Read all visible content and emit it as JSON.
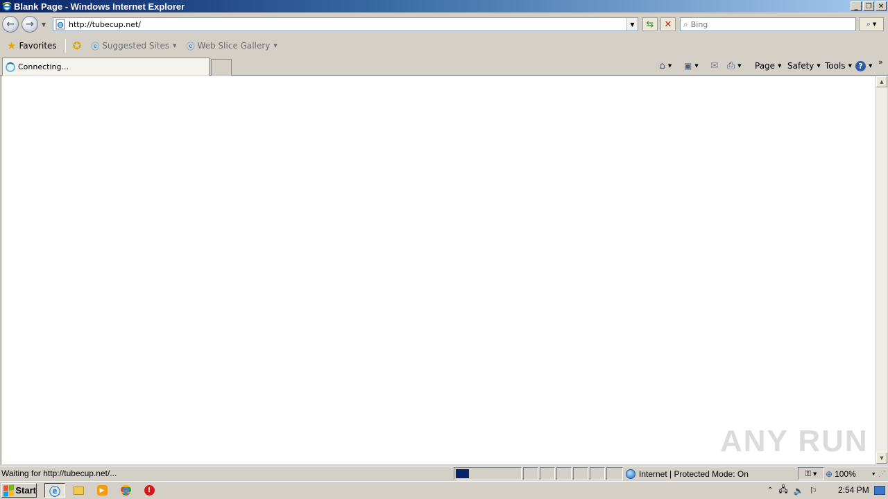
{
  "window": {
    "title": "Blank Page - Windows Internet Explorer",
    "minimize": "_",
    "restore": "❐",
    "close": "✕"
  },
  "nav": {
    "address": "http://tubecup.net/",
    "search_placeholder": "Bing"
  },
  "favorites": {
    "favorites_label": "Favorites",
    "items": [
      {
        "label": "Suggested Sites"
      },
      {
        "label": "Web Slice Gallery"
      }
    ]
  },
  "tab": {
    "label": "Connecting..."
  },
  "commands": {
    "page": "Page",
    "safety": "Safety",
    "tools": "Tools"
  },
  "status": {
    "text": "Waiting for http://tubecup.net/...",
    "zone": "Internet | Protected Mode: On",
    "zoom": "100%",
    "progress_fraction": 0.2
  },
  "taskbar": {
    "start": "Start",
    "clock": "2:54 PM"
  },
  "watermark": "ANY RUN",
  "colors": {
    "title_gradient_start": "#0a246a",
    "title_gradient_end": "#a6caf0",
    "chrome": "#d4d0c8",
    "progress": "#0a246a"
  }
}
